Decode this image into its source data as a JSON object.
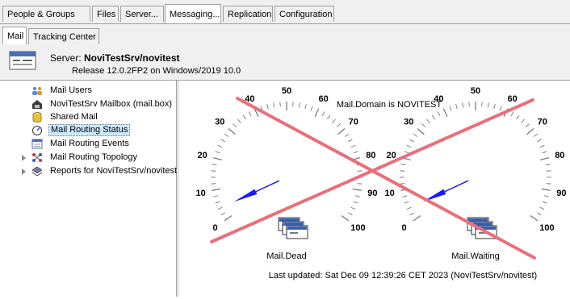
{
  "top_tabs": [
    {
      "label": "People & Groups",
      "active": false
    },
    {
      "label": "Files",
      "active": false
    },
    {
      "label": "Server...",
      "active": false
    },
    {
      "label": "Messaging...",
      "active": true
    },
    {
      "label": "Replication",
      "active": false
    },
    {
      "label": "Configuration",
      "active": false
    }
  ],
  "sub_tabs": [
    {
      "label": "Mail",
      "active": true
    },
    {
      "label": "Tracking Center",
      "active": false
    }
  ],
  "server": {
    "prefix": "Server: ",
    "name": "NoviTestSrv/novitest",
    "release": "Release 12.0.2FP2 on Windows/2019 10.0"
  },
  "nav_items": [
    {
      "label": "Mail Users",
      "icon": "users-icon",
      "expandable": false,
      "selected": false
    },
    {
      "label": "NoviTestSrv Mailbox (mail.box)",
      "icon": "mailbox-icon",
      "expandable": false,
      "selected": false
    },
    {
      "label": "Shared Mail",
      "icon": "database-icon",
      "expandable": false,
      "selected": false
    },
    {
      "label": "Mail Routing Status",
      "icon": "gauge-icon",
      "expandable": false,
      "selected": true
    },
    {
      "label": "Mail Routing Events",
      "icon": "events-icon",
      "expandable": false,
      "selected": false
    },
    {
      "label": "Mail Routing Topology",
      "icon": "topology-icon",
      "expandable": true,
      "selected": false
    },
    {
      "label": "Reports for NoviTestSrv/novitest",
      "icon": "reports-icon",
      "expandable": true,
      "selected": false
    }
  ],
  "status": {
    "domain_text": "Mail.Domain is NOVITEST",
    "updated_text": "Last updated: Sat Dec 09 12:39:26 CET 2023 (NoviTestSrv/novitest)",
    "gauges": [
      {
        "label": "Mail.Dead",
        "value": 4,
        "ticks": [
          "0",
          "10",
          "20",
          "30",
          "40",
          "50",
          "60",
          "70",
          "80",
          "90",
          "100"
        ]
      },
      {
        "label": "Mail.Waiting",
        "value": 4,
        "ticks": [
          "0",
          "10",
          "20",
          "30",
          "40",
          "50",
          "60",
          "70",
          "80",
          "90",
          "100"
        ]
      }
    ],
    "cross_color": "#e8707a",
    "needle_color": "#1a1aff"
  }
}
